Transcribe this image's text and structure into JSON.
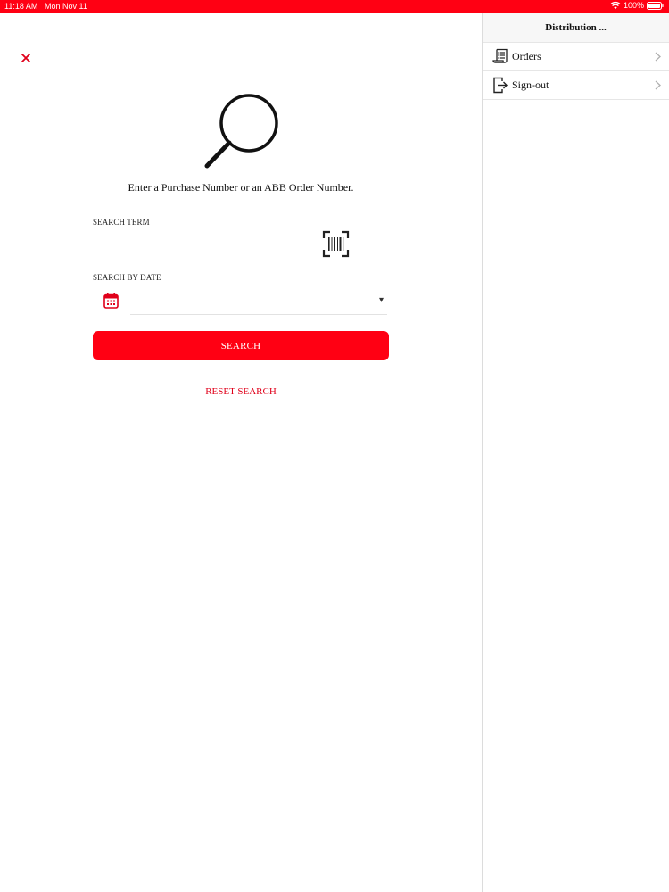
{
  "status_bar": {
    "time": "11:18 AM",
    "date": "Mon Nov 11",
    "battery": "100%"
  },
  "main": {
    "close_icon": "close-icon",
    "hero_icon": "magnifying-glass-icon",
    "instructions": "Enter a Purchase Number or an ABB Order Number.",
    "search_term_label": "SEARCH TERM",
    "search_term_value": "",
    "search_by_date_label": "SEARCH BY DATE",
    "date_value": "",
    "search_button": "SEARCH",
    "reset_link": "RESET SEARCH"
  },
  "side_panel": {
    "title": "Distribution ...",
    "items": [
      {
        "label": "Orders",
        "icon": "orders-icon"
      },
      {
        "label": "Sign-out",
        "icon": "sign-out-icon"
      }
    ]
  },
  "colors": {
    "brand_red": "#ff0013",
    "link_red": "#e0001a"
  }
}
